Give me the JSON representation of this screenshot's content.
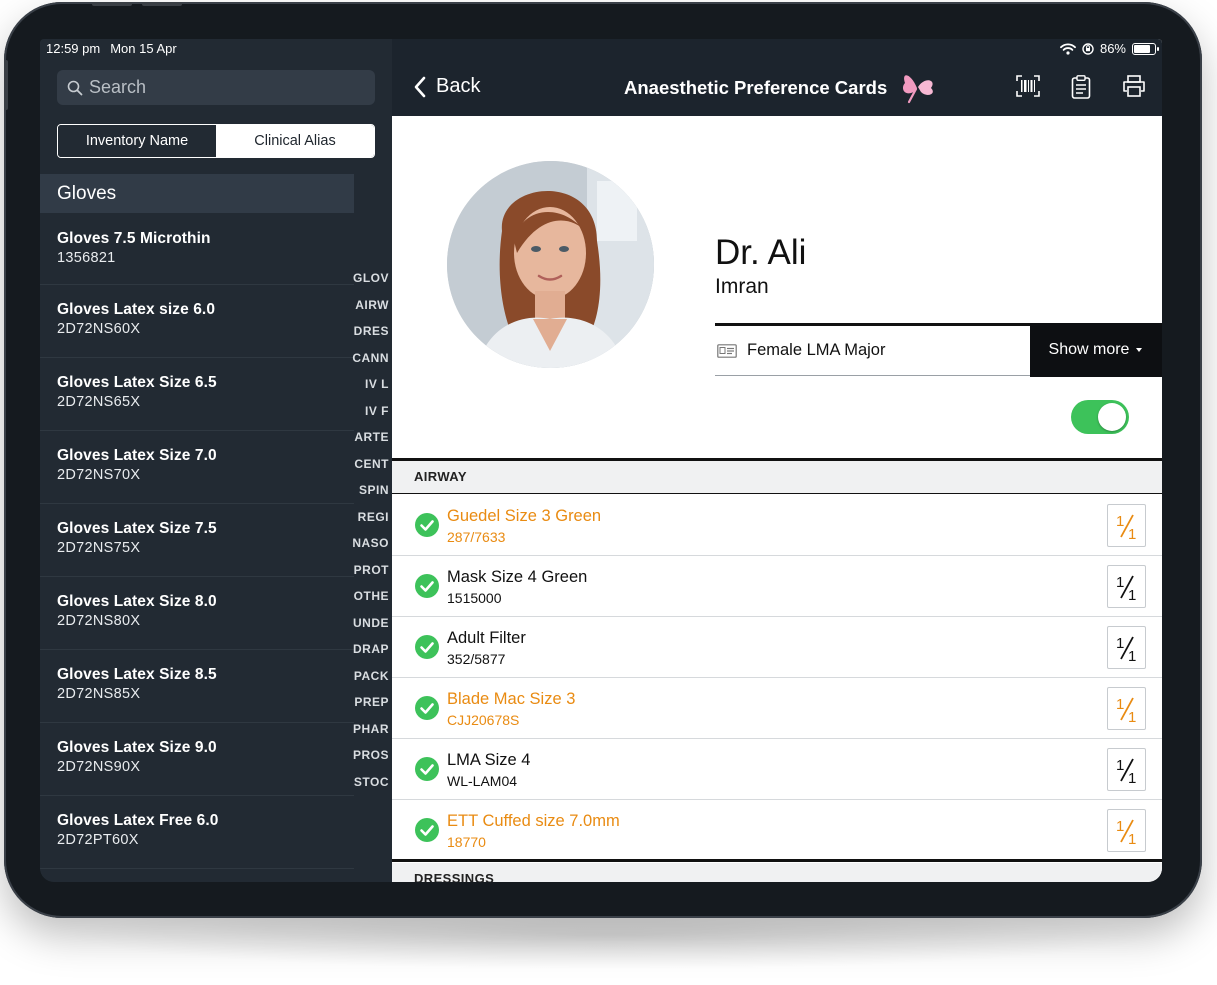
{
  "status": {
    "time": "12:59 pm",
    "date": "Mon 15 Apr",
    "battery": "86%",
    "battery_level": 0.86
  },
  "sidebar": {
    "search_placeholder": "Search",
    "segments": [
      {
        "label": "Inventory Name",
        "selected": false
      },
      {
        "label": "Clinical Alias",
        "selected": true
      }
    ],
    "section": "Gloves",
    "items": [
      {
        "name": "Gloves 7.5 Microthin",
        "code": "1356821"
      },
      {
        "name": "Gloves Latex size 6.0",
        "code": "2D72NS60X"
      },
      {
        "name": "Gloves Latex Size 6.5",
        "code": "2D72NS65X"
      },
      {
        "name": "Gloves Latex Size 7.0",
        "code": "2D72NS70X"
      },
      {
        "name": "Gloves Latex Size 7.5",
        "code": "2D72NS75X"
      },
      {
        "name": "Gloves Latex Size 8.0",
        "code": "2D72NS80X"
      },
      {
        "name": "Gloves Latex Size 8.5",
        "code": "2D72NS85X"
      },
      {
        "name": "Gloves Latex Size 9.0",
        "code": "2D72NS90X"
      },
      {
        "name": "Gloves Latex Free 6.0",
        "code": "2D72PT60X"
      }
    ],
    "index": [
      "GLOV",
      "AIRW",
      "DRES",
      "CANN",
      "IV L",
      "IV F",
      "ARTE",
      "CENT",
      "SPIN",
      "REGI",
      "NASO",
      "PROT",
      "OTHE",
      "UNDE",
      "DRAP",
      "PACK",
      "PREP",
      "PHAR",
      "PROS",
      "STOC"
    ]
  },
  "topbar": {
    "back_label": "Back",
    "title": "Anaesthetic Preference Cards"
  },
  "profile": {
    "first_name": "Dr. Ali",
    "last_name": "Imran",
    "card_label": "Female LMA Major",
    "show_more": "Show more",
    "toggle_on": true
  },
  "categories": {
    "airway": "AIRWAY",
    "dressings": "DRESSINGS"
  },
  "airway_items": [
    {
      "name": "Guedel Size 3 Green",
      "code": "287/7633",
      "color": "#e98b12",
      "highlight": true
    },
    {
      "name": "Mask Size 4 Green",
      "code": "1515000",
      "color": "#111111",
      "highlight": false
    },
    {
      "name": "Adult Filter",
      "code": "352/5877",
      "color": "#111111",
      "highlight": false
    },
    {
      "name": "Blade Mac Size 3",
      "code": "CJJ20678S",
      "color": "#e98b12",
      "highlight": true
    },
    {
      "name": "LMA Size 4",
      "code": "WL-LAM04",
      "color": "#111111",
      "highlight": false
    },
    {
      "name": "ETT Cuffed size 7.0mm",
      "code": "18770",
      "color": "#e98b12",
      "highlight": true
    }
  ],
  "colors": {
    "accent": "#e98b12",
    "check_green": "#3dc25a",
    "sidebar_bg": "#222a33",
    "topbar_bg": "#1c242d",
    "butterfly": "#f19bc0"
  }
}
